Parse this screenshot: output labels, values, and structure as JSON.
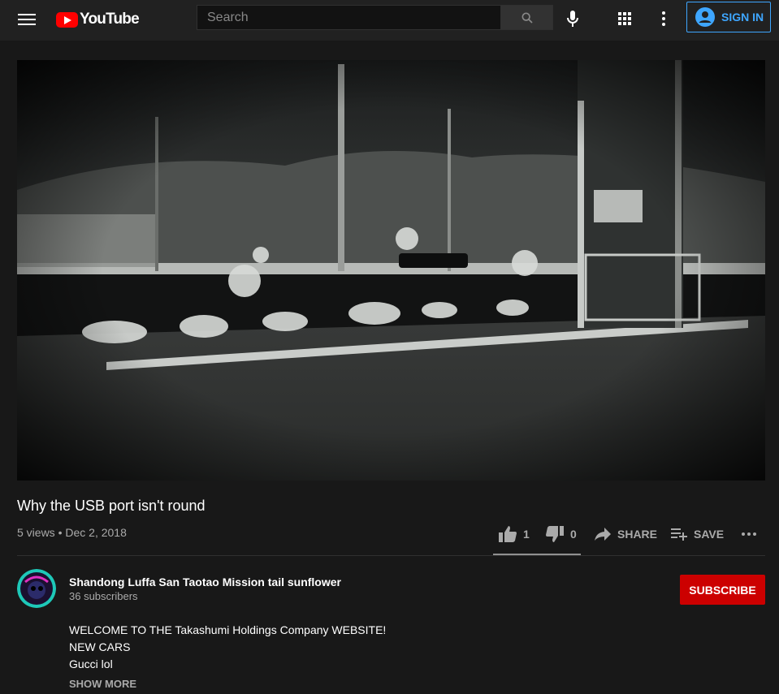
{
  "header": {
    "logo_text": "YouTube",
    "search_placeholder": "Search",
    "signin_label": "SIGN IN"
  },
  "icons": [
    "menu-icon",
    "youtube-logo-icon",
    "search-icon",
    "mic-icon",
    "apps-grid-icon",
    "more-vert-icon",
    "account-circle-icon",
    "thumb-up-icon",
    "thumb-down-icon",
    "share-icon",
    "playlist-add-icon",
    "more-horiz-icon"
  ],
  "colors": {
    "brand_red": "#ff0000",
    "subscribe_red": "#cc0000",
    "link_blue": "#3ea6ff",
    "background": "#181818",
    "topbar": "#212121"
  },
  "video": {
    "title": "Why the USB port isn't round",
    "views": "5 views",
    "separator": "•",
    "date": "Dec 2, 2018"
  },
  "actions": {
    "likes": "1",
    "dislikes": "0",
    "share_label": "SHARE",
    "save_label": "SAVE"
  },
  "channel": {
    "name": "Shandong Luffa San Taotao Mission tail sunflower",
    "subscribers": "36 subscribers",
    "subscribe_label": "SUBSCRIBE"
  },
  "description": {
    "lines": [
      "WELCOME TO THE Takashumi Holdings Company WEBSITE!",
      "NEW CARS",
      "Gucci lol"
    ],
    "show_more_label": "SHOW MORE"
  }
}
